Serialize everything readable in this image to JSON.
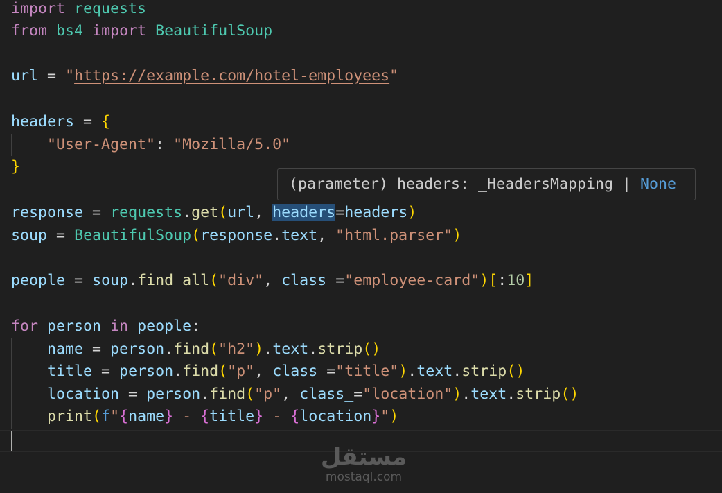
{
  "code": {
    "l1": [
      "import",
      "requests"
    ],
    "l2": [
      "from",
      "bs4",
      "import",
      "BeautifulSoup"
    ],
    "l4": [
      "url",
      "=",
      "\"",
      "https://example.com/hotel-employees",
      "\""
    ],
    "l6": [
      "headers",
      "=",
      "{"
    ],
    "l7": [
      "\"User-Agent\"",
      ":",
      "\"Mozilla/5.0\""
    ],
    "l8": [
      "}"
    ],
    "l10": [
      "response",
      "=",
      "requests",
      ".",
      "get",
      "(",
      "url",
      ",",
      "headers",
      "=",
      "headers",
      ")"
    ],
    "l11": [
      "soup",
      "=",
      "BeautifulSoup",
      "(",
      "response",
      ".",
      "text",
      ",",
      "\"html.parser\"",
      ")"
    ],
    "l13": [
      "people",
      "=",
      "soup",
      ".",
      "find_all",
      "(",
      "\"div\"",
      ",",
      "class_",
      "=",
      "\"employee-card\"",
      ")",
      "[",
      ":",
      "10",
      "]"
    ],
    "l15": [
      "for",
      "person",
      "in",
      "people",
      ":"
    ],
    "l16": [
      "name",
      "=",
      "person",
      ".",
      "find",
      "(",
      "\"h2\"",
      ")",
      ".",
      "text",
      ".",
      "strip",
      "()"
    ],
    "l17": [
      "title",
      "=",
      "person",
      ".",
      "find",
      "(",
      "\"p\"",
      ",",
      "class_",
      "=",
      "\"title\"",
      ")",
      ".",
      "text",
      ".",
      "strip",
      "()"
    ],
    "l18": [
      "location",
      "=",
      "person",
      ".",
      "find",
      "(",
      "\"p\"",
      ",",
      "class_",
      "=",
      "\"location\"",
      ")",
      ".",
      "text",
      ".",
      "strip",
      "()"
    ],
    "l19": [
      "print",
      "(",
      "f",
      "\"",
      "{",
      "name",
      "}",
      " - ",
      "{",
      "title",
      "}",
      " - ",
      "{",
      "location",
      "}",
      "\"",
      ")"
    ]
  },
  "hover": {
    "text": "(parameter) headers: _HeadersMapping | ",
    "none": "None"
  },
  "watermark": {
    "logo": "مستقل",
    "site": "mostaql.com"
  }
}
